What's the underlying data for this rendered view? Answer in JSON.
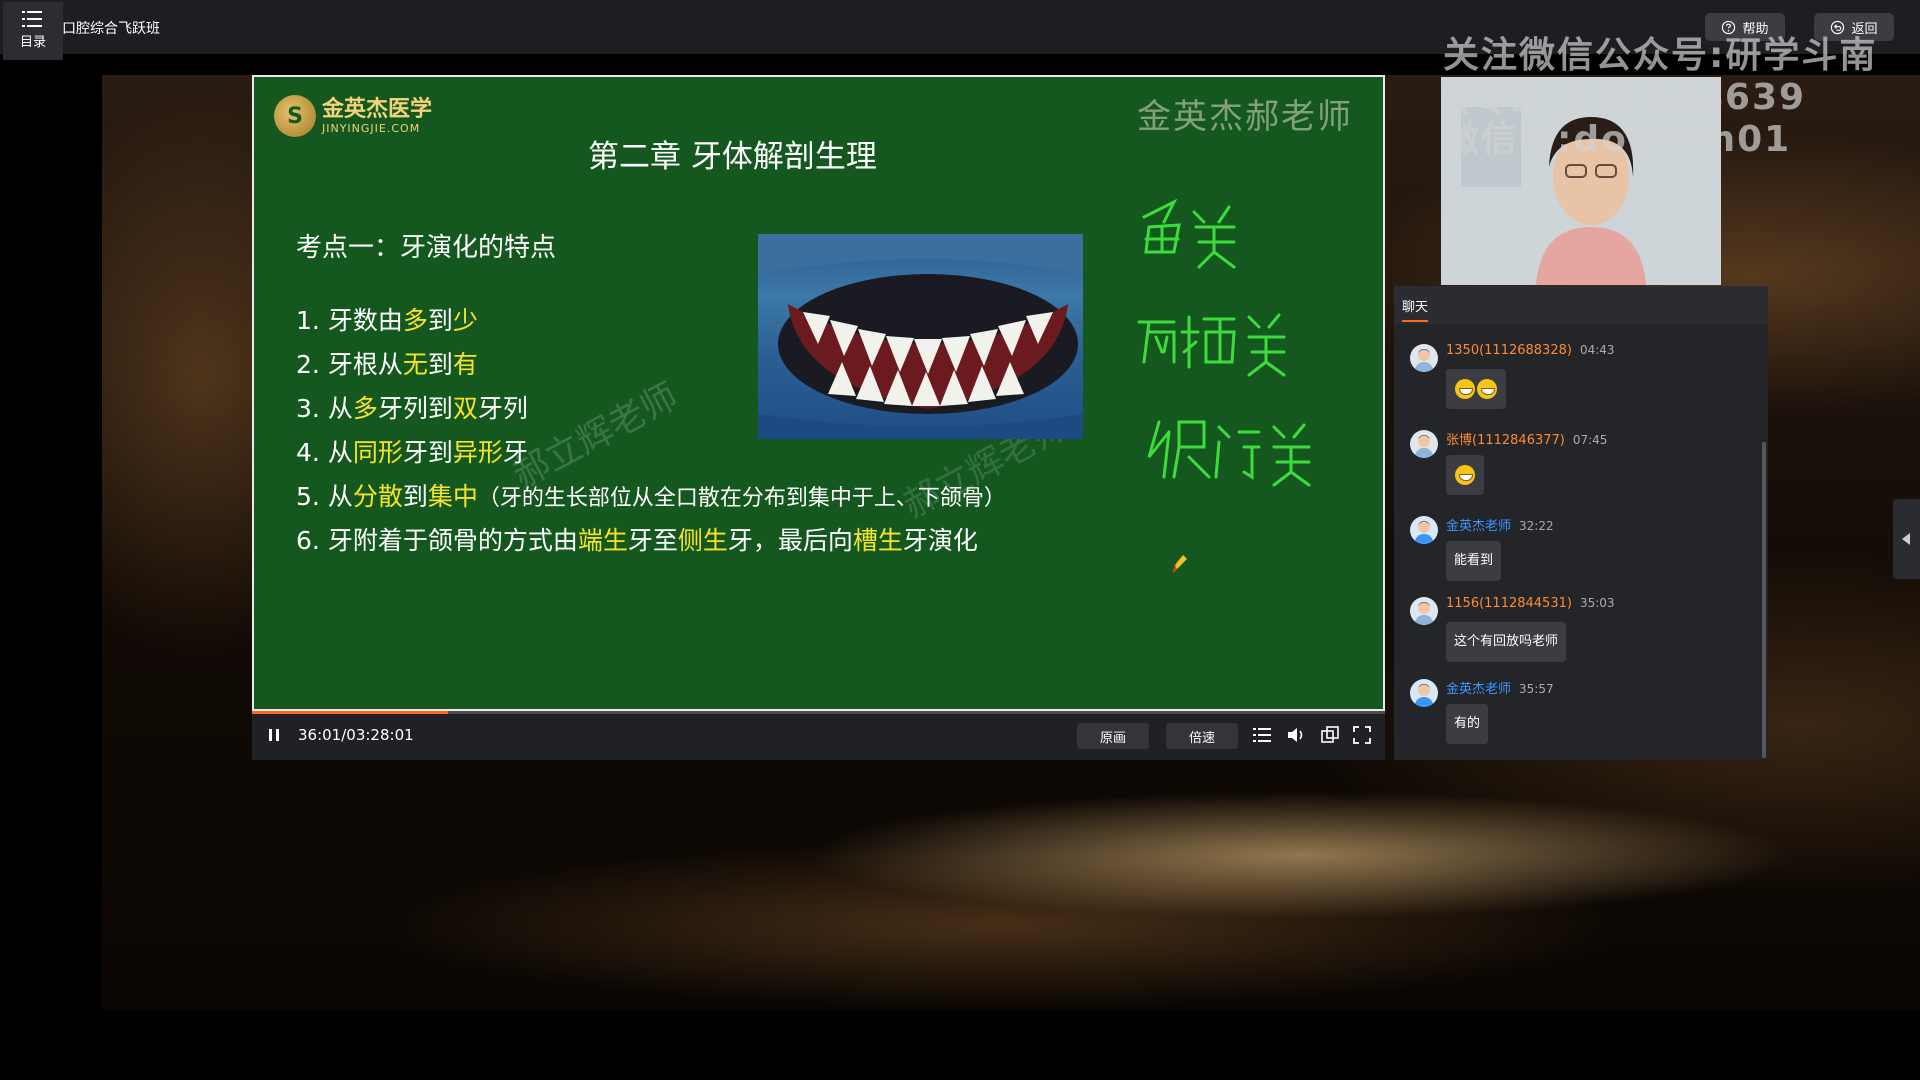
{
  "topbar": {
    "menu_label": "目录",
    "course_title": "口腔综合飞跃班",
    "help_label": "帮助",
    "back_label": "返回"
  },
  "slide": {
    "logo_name": "金英杰医学",
    "logo_url": "JINYINGJIE.COM",
    "watermark_top_right": "金英杰郝老师",
    "watermark_diagonal_1": "郝立辉老师",
    "watermark_diagonal_2": "郝立辉老师",
    "chapter_title": "第二章  牙体解剖生理",
    "kaodian": "考点一：牙演化的特点",
    "points": [
      {
        "n": "1. ",
        "segs": [
          [
            "牙数由",
            false
          ],
          [
            "多",
            true
          ],
          [
            "到",
            false
          ],
          [
            "少",
            true
          ]
        ]
      },
      {
        "n": "2. ",
        "segs": [
          [
            "牙根从",
            false
          ],
          [
            "无",
            true
          ],
          [
            "到",
            false
          ],
          [
            "有",
            true
          ]
        ]
      },
      {
        "n": "3. ",
        "segs": [
          [
            "从",
            false
          ],
          [
            "多",
            true
          ],
          [
            "牙列到",
            false
          ],
          [
            "双",
            true
          ],
          [
            "牙列",
            false
          ]
        ]
      },
      {
        "n": "4. ",
        "segs": [
          [
            "从",
            false
          ],
          [
            "同形",
            true
          ],
          [
            "牙到",
            false
          ],
          [
            "异形",
            true
          ],
          [
            "牙",
            false
          ]
        ]
      },
      {
        "n": "5. ",
        "segs": [
          [
            "从",
            false
          ],
          [
            "分散",
            true
          ],
          [
            "到",
            false
          ],
          [
            "集中",
            true
          ]
        ],
        "paren": "（牙的生长部位从全口散在分布到集中于上、下颌骨）"
      },
      {
        "n": "6. ",
        "segs": [
          [
            "牙附着于颌骨的方式由",
            false
          ],
          [
            "端生",
            true
          ],
          [
            "牙至",
            false
          ],
          [
            "侧生",
            true
          ],
          [
            "牙，最后向",
            false
          ],
          [
            "槽生",
            true
          ],
          [
            "牙演化",
            false
          ]
        ]
      }
    ],
    "handwriting": [
      "鱼类",
      "两栖类",
      "爬行类"
    ],
    "colors": {
      "board": "#14581f",
      "highlight": "#f6e32a",
      "handwriting": "#3ddc3d"
    }
  },
  "player": {
    "time": "36:01/03:28:01",
    "progress": 0.173,
    "quality_label": "原画",
    "speed_label": "倍速"
  },
  "watermark_promo": [
    "关注微信公众号:研学斗南",
    "QQ群:751484639",
    "微信号:dounan01"
  ],
  "chat": {
    "tab_label": "聊天",
    "messages": [
      {
        "name": "1350(1112688328)",
        "time": "04:43",
        "role": "user",
        "text": "",
        "emojis": 2
      },
      {
        "name": "张博(1112846377)",
        "time": "07:45",
        "role": "user",
        "text": "",
        "emojis": 1
      },
      {
        "name": "金英杰老师",
        "time": "32:22",
        "role": "teacher",
        "text": "能看到",
        "emojis": 0
      },
      {
        "name": "1156(1112844531)",
        "time": "35:03",
        "role": "user",
        "text": "这个有回放吗老师",
        "emojis": 0
      },
      {
        "name": "金英杰老师",
        "time": "35:57",
        "role": "teacher",
        "text": "有的",
        "emojis": 0
      }
    ],
    "colors": {
      "user_name": "#ff8a33",
      "teacher_name": "#3c95ff"
    }
  }
}
